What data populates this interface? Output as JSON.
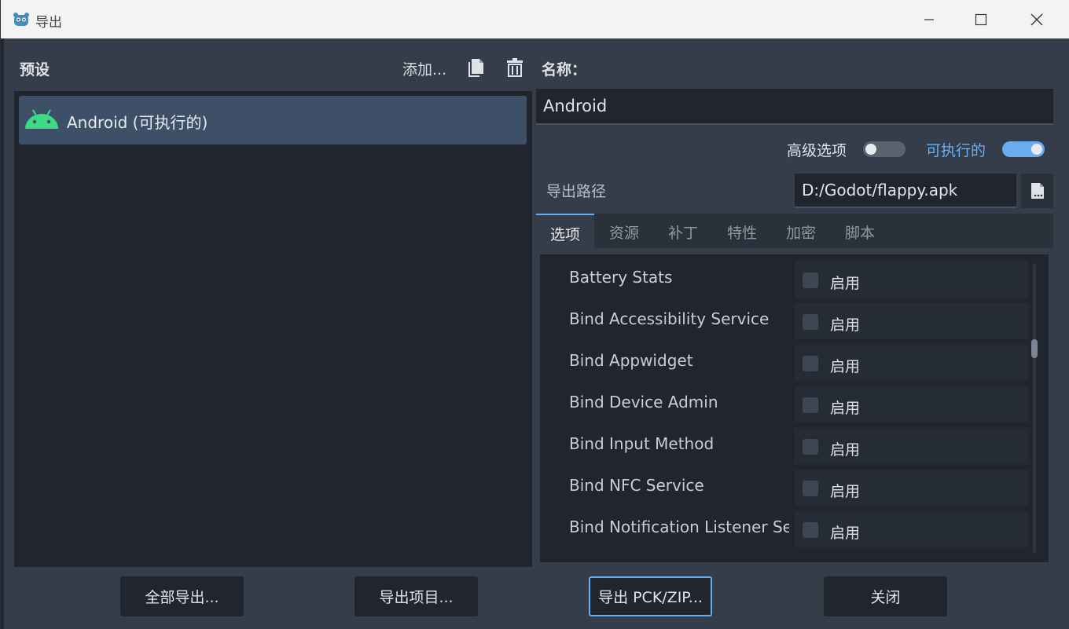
{
  "window": {
    "title": "导出"
  },
  "presets": {
    "heading": "预设",
    "add_label": "添加...",
    "items": [
      {
        "label": "Android (可执行的)",
        "icon": "android-icon",
        "selected": true
      }
    ]
  },
  "details": {
    "name_label": "名称：",
    "name_value": "Android",
    "advanced_label": "高级选项",
    "advanced_on": false,
    "runnable_label": "可执行的",
    "runnable_on": true,
    "export_path_label": "导出路径",
    "export_path_value": "D:/Godot/flappy.apk"
  },
  "tabs": [
    {
      "label": "选项",
      "active": true
    },
    {
      "label": "资源",
      "active": false
    },
    {
      "label": "补丁",
      "active": false
    },
    {
      "label": "特性",
      "active": false
    },
    {
      "label": "加密",
      "active": false
    },
    {
      "label": "脚本",
      "active": false
    }
  ],
  "options": [
    {
      "label": "Battery Stats",
      "value_label": "启用",
      "checked": false
    },
    {
      "label": "Bind Accessibility Service",
      "value_label": "启用",
      "checked": false
    },
    {
      "label": "Bind Appwidget",
      "value_label": "启用",
      "checked": false
    },
    {
      "label": "Bind Device Admin",
      "value_label": "启用",
      "checked": false
    },
    {
      "label": "Bind Input Method",
      "value_label": "启用",
      "checked": false
    },
    {
      "label": "Bind NFC Service",
      "value_label": "启用",
      "checked": false
    },
    {
      "label": "Bind Notification Listener Se",
      "value_label": "启用",
      "checked": false
    }
  ],
  "buttons": {
    "export_all": "全部导出...",
    "export_project": "导出项目...",
    "export_pck_zip": "导出 PCK/ZIP...",
    "close": "关闭"
  },
  "colors": {
    "accent": "#69acef",
    "selected_item": "#3d5068",
    "android_green": "#3ddc84"
  }
}
